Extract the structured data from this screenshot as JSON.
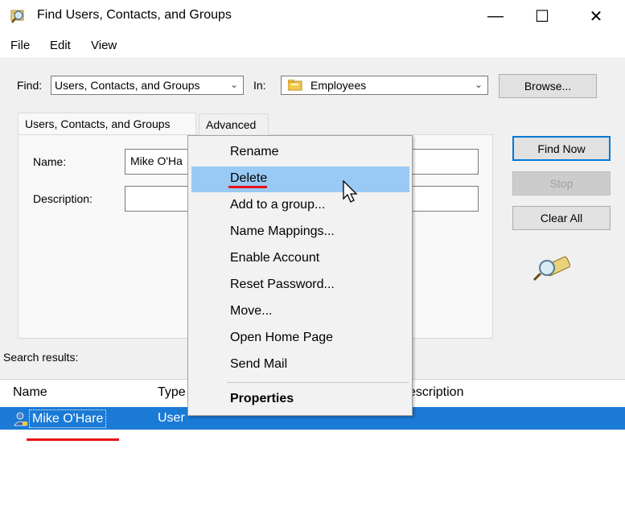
{
  "window": {
    "title": "Find Users, Contacts, and Groups",
    "controls": {
      "minimize": "—",
      "maximize": "☐",
      "close": "✕"
    }
  },
  "menubar": {
    "items": [
      "File",
      "Edit",
      "View"
    ]
  },
  "find_row": {
    "find_label": "Find:",
    "find_value": "Users, Contacts, and Groups",
    "in_label": "In:",
    "in_value": "Employees",
    "browse_label": "Browse..."
  },
  "tabs": {
    "tab1": "Users, Contacts, and Groups",
    "tab2": "Advanced"
  },
  "form": {
    "name_label": "Name:",
    "name_value": "Mike O'Ha",
    "description_label": "Description:",
    "description_value": ""
  },
  "buttons": {
    "find_now": "Find Now",
    "stop": "Stop",
    "clear_all": "Clear All"
  },
  "search_results_label": "Search results:",
  "results": {
    "columns": [
      "Name",
      "Type",
      "Description"
    ],
    "header_visible": {
      "name": "Name",
      "type": "Type",
      "description": "escription"
    },
    "rows": [
      {
        "name": "Mike O'Hare",
        "type": "User",
        "description": ""
      }
    ]
  },
  "context_menu": {
    "items": [
      "Rename",
      "Delete",
      "Add to a group...",
      "Name Mappings...",
      "Enable Account",
      "Reset Password...",
      "Move...",
      "Open Home Page",
      "Send Mail"
    ],
    "bold_item": "Properties",
    "highlighted_item": "Delete"
  },
  "colors": {
    "selection": "#1a7ad6",
    "menu_highlight": "#99c9f5",
    "annotation": "#e8121a",
    "accent": "#0078d7"
  },
  "icons": [
    "find-search-icon",
    "folder-icon",
    "user-icon",
    "flashlight-icon",
    "mouse-cursor-icon"
  ]
}
